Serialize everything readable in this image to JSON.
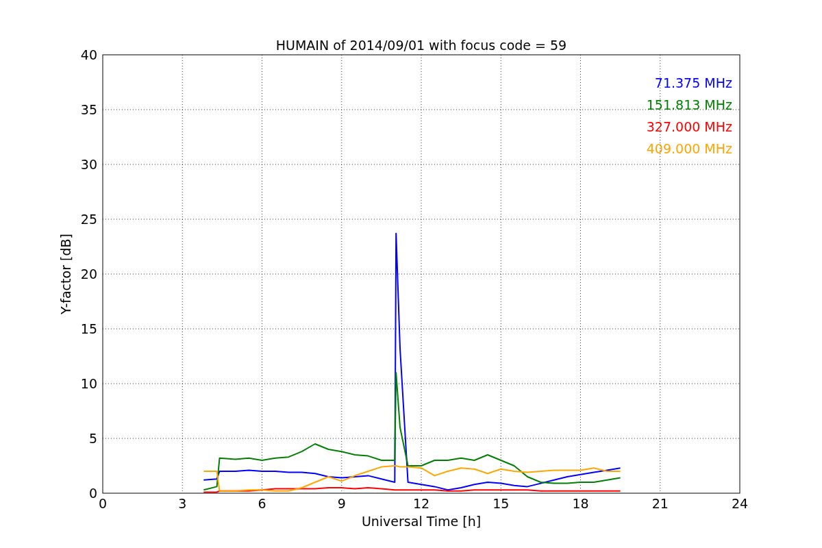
{
  "chart_data": {
    "type": "line",
    "title": "HUMAIN of 2014/09/01 with focus code = 59",
    "xlabel": "Universal Time [h]",
    "ylabel": "Y-factor [dB]",
    "x": [
      3.8,
      4.3,
      4.4,
      5,
      5.5,
      6,
      6.5,
      7,
      7.5,
      8,
      8.5,
      9,
      9.5,
      10,
      10.5,
      11,
      11.05,
      11.2,
      11.5,
      12,
      12.5,
      13,
      13.5,
      14,
      14.5,
      15,
      15.5,
      16,
      16.5,
      17,
      17.5,
      18,
      18.5,
      19,
      19.5
    ],
    "series": [
      {
        "name": "71.375 MHz",
        "color": "#0000ff",
        "values": [
          1.2,
          1.3,
          2.0,
          2.0,
          2.1,
          2.0,
          2.0,
          1.9,
          1.9,
          1.8,
          1.5,
          1.4,
          1.5,
          1.6,
          1.3,
          1.0,
          23.7,
          13.2,
          1.0,
          0.8,
          0.6,
          0.3,
          0.5,
          0.8,
          1.0,
          0.9,
          0.7,
          0.6,
          0.9,
          1.2,
          1.5,
          1.7,
          1.9,
          2.1,
          2.3
        ]
      },
      {
        "name": "151.813 MHz",
        "color": "#008000",
        "values": [
          0.3,
          0.6,
          3.2,
          3.1,
          3.2,
          3.0,
          3.2,
          3.3,
          3.8,
          4.5,
          4.0,
          3.8,
          3.5,
          3.4,
          3.0,
          3.0,
          11.0,
          6.0,
          2.5,
          2.5,
          3.0,
          3.0,
          3.2,
          3.0,
          3.5,
          3.0,
          2.5,
          1.5,
          1.0,
          0.9,
          0.9,
          1.0,
          1.0,
          1.2,
          1.4
        ]
      },
      {
        "name": "327.000 MHz",
        "color": "#ff0000",
        "values": [
          0.1,
          0.1,
          0.2,
          0.2,
          0.2,
          0.3,
          0.4,
          0.4,
          0.4,
          0.4,
          0.5,
          0.5,
          0.4,
          0.5,
          0.4,
          0.3,
          0.3,
          0.3,
          0.3,
          0.3,
          0.3,
          0.2,
          0.2,
          0.3,
          0.3,
          0.3,
          0.3,
          0.3,
          0.2,
          0.2,
          0.2,
          0.2,
          0.2,
          0.2,
          0.2
        ]
      },
      {
        "name": "409.000 MHz",
        "color": "#ffa500",
        "values": [
          2.0,
          2.0,
          0.2,
          0.2,
          0.3,
          0.3,
          0.2,
          0.2,
          0.5,
          1.0,
          1.5,
          1.1,
          1.6,
          2.0,
          2.4,
          2.5,
          2.5,
          2.4,
          2.4,
          2.3,
          1.6,
          2.0,
          2.3,
          2.2,
          1.8,
          2.2,
          2.0,
          1.9,
          2.0,
          2.1,
          2.1,
          2.1,
          2.3,
          2.0,
          2.0
        ]
      }
    ],
    "xlim": [
      0,
      24
    ],
    "ylim": [
      0,
      40
    ],
    "xticks": [
      0,
      3,
      6,
      9,
      12,
      15,
      18,
      21,
      24
    ],
    "yticks": [
      0,
      5,
      10,
      15,
      20,
      25,
      30,
      35,
      40
    ],
    "grid": true
  }
}
